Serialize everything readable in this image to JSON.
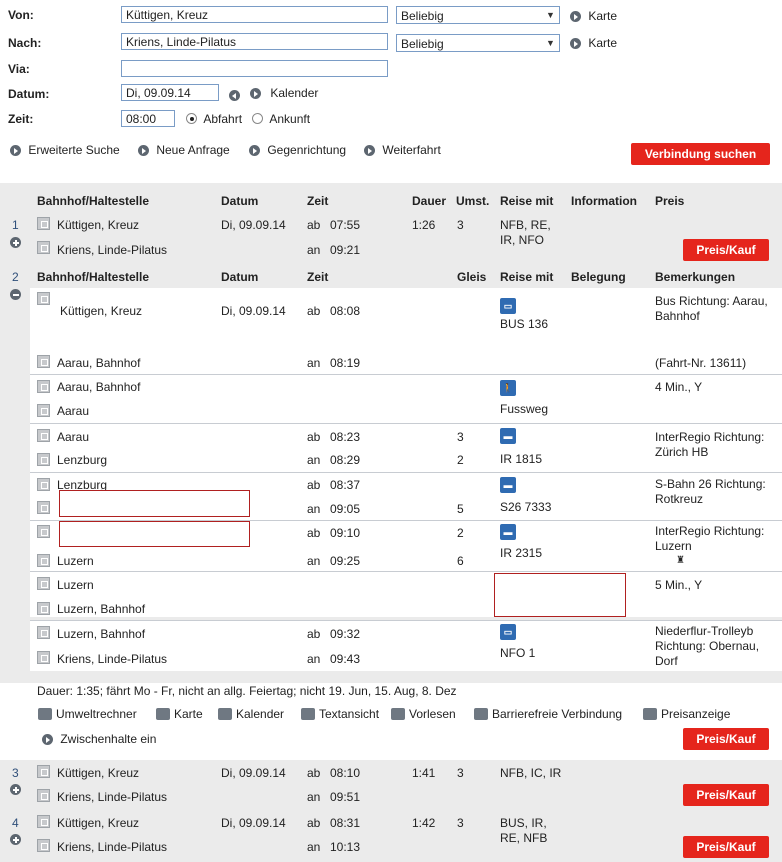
{
  "form": {
    "von_label": "Von:",
    "von_value": "Küttigen, Kreuz",
    "von_select": "Beliebig",
    "nach_label": "Nach:",
    "nach_value": "Kriens, Linde-Pilatus",
    "nach_select": "Beliebig",
    "karte": "Karte",
    "via_label": "Via:",
    "via_value": "",
    "datum_label": "Datum:",
    "datum_value": "Di, 09.09.14",
    "kalender": "Kalender",
    "zeit_label": "Zeit:",
    "zeit_value": "08:00",
    "abfahrt": "Abfahrt",
    "ankunft": "Ankunft",
    "links": [
      "Erweiterte Suche",
      "Neue Anfrage",
      "Gegenrichtung",
      "Weiterfahrt"
    ],
    "search_button": "Verbindung suchen"
  },
  "results": {
    "headers": {
      "station": "Bahnhof/Haltestelle",
      "datum": "Datum",
      "zeit": "Zeit",
      "dauer": "Dauer",
      "umst": "Umst.",
      "reise": "Reise mit",
      "info": "Information",
      "preis": "Preis"
    },
    "detail_headers": {
      "station": "Bahnhof/Haltestelle",
      "datum": "Datum",
      "zeit": "Zeit",
      "gleis": "Gleis",
      "reise": "Reise mit",
      "belegung": "Belegung",
      "bemerkungen": "Bemerkungen"
    },
    "price_button": "Preis/Kauf",
    "connections": [
      {
        "num": "1",
        "from": "Küttigen, Kreuz",
        "to": "Kriens, Linde-Pilatus",
        "date": "Di, 09.09.14",
        "dep_kind": "ab",
        "dep": "07:55",
        "arr_kind": "an",
        "arr": "09:21",
        "dauer": "1:26",
        "umst": "3",
        "reise": "NFB, RE, IR, NFO"
      },
      {
        "num": "3",
        "from": "Küttigen, Kreuz",
        "to": "Kriens, Linde-Pilatus",
        "date": "Di, 09.09.14",
        "dep_kind": "ab",
        "dep": "08:10",
        "arr_kind": "an",
        "arr": "09:51",
        "dauer": "1:41",
        "umst": "3",
        "reise": "NFB, IC, IR"
      },
      {
        "num": "4",
        "from": "Küttigen, Kreuz",
        "to": "Kriens, Linde-Pilatus",
        "date": "Di, 09.09.14",
        "dep_kind": "ab",
        "dep": "08:31",
        "arr_kind": "an",
        "arr": "10:13",
        "dauer": "1:42",
        "umst": "3",
        "reise": "BUS, IR, RE, NFB"
      }
    ],
    "detail": {
      "num": "2",
      "legs": [
        {
          "from": "Küttigen, Kreuz",
          "from_date": "Di, 09.09.14",
          "dep_kind": "ab",
          "dep": "08:08",
          "dep_gleis": "",
          "to": "Aarau, Bahnhof",
          "arr_kind": "an",
          "arr": "08:19",
          "arr_gleis": "",
          "mode_icon": "bus-icon",
          "mode": "BUS 136",
          "remark": "Bus Richtung: Aarau, Bahnhof",
          "remark2": "(Fahrt-Nr. 13611)"
        },
        {
          "from": "Aarau, Bahnhof",
          "to": "Aarau",
          "mode_icon": "walk-icon",
          "mode": "Fussweg",
          "remark": "4 Min., Y"
        },
        {
          "from": "Aarau",
          "dep_kind": "ab",
          "dep": "08:23",
          "dep_gleis": "3",
          "to": "Lenzburg",
          "arr_kind": "an",
          "arr": "08:29",
          "arr_gleis": "2",
          "mode_icon": "train-icon",
          "mode": "IR 1815",
          "remark": "InterRegio Richtung: Zürich HB"
        },
        {
          "from": "Lenzburg",
          "dep_kind": "ab",
          "dep": "08:37",
          "dep_gleis": "",
          "to": "",
          "arr_kind": "an",
          "arr": "09:05",
          "arr_gleis": "5",
          "mode_icon": "train-icon",
          "mode": "S26 7333",
          "remark": "S-Bahn 26 Richtung: Rotkreuz"
        },
        {
          "from": "",
          "dep_kind": "ab",
          "dep": "09:10",
          "dep_gleis": "2",
          "to": "Luzern",
          "arr_kind": "an",
          "arr": "09:25",
          "arr_gleis": "6",
          "mode_icon": "train-icon",
          "mode": "IR 2315",
          "remark": "InterRegio Richtung: Luzern"
        },
        {
          "from": "Luzern",
          "to": "Luzern, Bahnhof",
          "remark": "5 Min., Y"
        },
        {
          "from": "Luzern, Bahnhof",
          "dep_kind": "ab",
          "dep": "09:32",
          "to": "Kriens, Linde-Pilatus",
          "arr_kind": "an",
          "arr": "09:43",
          "mode_icon": "bus-icon",
          "mode": "NFO 1",
          "remark": "Niederflur-Trolleyb Richtung: Obernau, Dorf"
        }
      ],
      "summary": "Dauer: 1:35; fährt Mo - Fr, nicht an allg. Feiertag; nicht 19. Jun, 15. Aug, 8. Dez",
      "tools": [
        "Umweltrechner",
        "Karte",
        "Kalender",
        "Textansicht",
        "Vorlesen",
        "Barrierefreie Verbindung",
        "Preisanzeige"
      ],
      "zwischenhalte": "Zwischenhalte ein"
    }
  },
  "colors": {
    "accent_red": "#e5251c",
    "header_grey": "#ebebeb",
    "mode_blue": "#2f6bb2"
  }
}
